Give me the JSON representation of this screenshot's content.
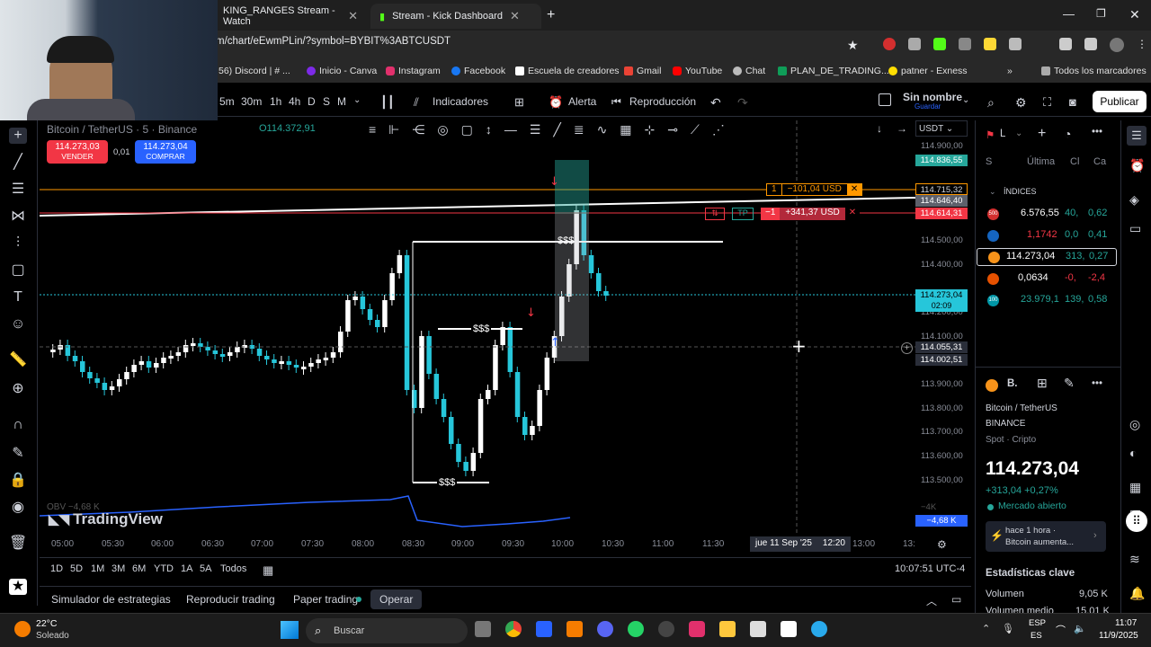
{
  "browser": {
    "tabs": [
      {
        "label": "KING_RANGES Stream - Watch"
      },
      {
        "label": "Stream - Kick Dashboard"
      }
    ],
    "url": "m/chart/eEwmPLin/?symbol=BYBIT%3ABTCUSDT",
    "bookmarks": [
      "56) Discord | # ...",
      "Inicio - Canva",
      "Instagram",
      "Facebook",
      "Escuela de creadores",
      "Gmail",
      "YouTube",
      "Chat",
      "PLAN_DE_TRADING...",
      "patner - Exness",
      "Todos los marcadores"
    ]
  },
  "toolbar": {
    "intervals": [
      "5m",
      "30m",
      "1h",
      "4h",
      "D",
      "S",
      "M"
    ],
    "indicators": "Indicadores",
    "alert": "Alerta",
    "replay": "Reproducción",
    "layout_name": "Sin nombre",
    "layout_saved": "Guardar",
    "publish": "Publicar"
  },
  "symbol": {
    "title": "Bitcoin / TetherUS · 5 · Binance",
    "open_label": "O114.372,91",
    "sell_price": "114.273,03",
    "sell_label": "VENDER",
    "spread": "0,01",
    "buy_price": "114.273,04",
    "buy_label": "COMPRAR",
    "quote_currency": "USDT"
  },
  "chart_data": {
    "type": "candlestick",
    "yaxis_ticks": [
      "114.900,00",
      "114.500,00",
      "114.400,00",
      "114.200,00",
      "114.100,00",
      "113.900,00",
      "113.800,00",
      "113.700,00",
      "113.600,00",
      "113.500,00"
    ],
    "xaxis_ticks": [
      "05:00",
      "05:30",
      "06:00",
      "06:30",
      "07:00",
      "07:30",
      "08:00",
      "08:30",
      "09:00",
      "09:30",
      "10:00",
      "10:30",
      "11:00",
      "11:30",
      "13:00",
      "13:"
    ],
    "crosshair_date": "jue 11 Sep '25",
    "crosshair_time": "12:20",
    "price_tags": [
      {
        "value": "114.836,55",
        "color": "#26a69a"
      },
      {
        "value": "114.715,32",
        "color": "#000000"
      },
      {
        "value": "114.646,40",
        "color": "#5d606b"
      },
      {
        "value": "114.614,31",
        "color": "#f23645"
      },
      {
        "value": "114.273,04",
        "color": "#26c6da"
      },
      {
        "value": "02:09",
        "color": "#26c6da"
      },
      {
        "value": "114.055,31",
        "color": "#2a2e39"
      },
      {
        "value": "114.002,51",
        "color": "#2a2e39"
      }
    ],
    "orders": {
      "limit_qty": "1",
      "limit_pnl": "−101,04 USD",
      "position_qty": "−1",
      "position_pnl": "+341,37 USD",
      "tp_label": "TP"
    },
    "liquidity_label": "$$$",
    "obv_label": "OBV −4,68 K",
    "obv_value": "−4,68 K",
    "obv_tick": "−4K",
    "watermark": "TradingView"
  },
  "range": {
    "buttons": [
      "1D",
      "5D",
      "1M",
      "3M",
      "6M",
      "YTD",
      "1A",
      "5A",
      "Todos"
    ],
    "clock": "10:07:51 UTC-4"
  },
  "bottom": {
    "tabs": [
      "Simulador de estrategias",
      "Reproducir trading",
      "Paper trading",
      "Operar"
    ]
  },
  "watchlist": {
    "header": "L",
    "cols": [
      "S",
      "Última",
      "Cl",
      "Ca"
    ],
    "section": "ÍNDICES",
    "rows": [
      {
        "icon": "500",
        "last": "6.576,55",
        "chg": "40,",
        "pct": "0,62",
        "color": "#26a69a",
        "iconcolor": "#d32f2f"
      },
      {
        "icon": "",
        "last": "1,1742",
        "chg": "0,0",
        "pct": "0,41",
        "color": "#f23645",
        "iconcolor": "#1565c0"
      },
      {
        "icon": "",
        "last": "114.273,04",
        "chg": "313,",
        "pct": "0,27",
        "color": "#ffffff",
        "iconcolor": "#f7931a"
      },
      {
        "icon": "",
        "last": "0,0634",
        "chg": "-0,",
        "pct": "-2,4",
        "color": "#ffffff",
        "iconcolor": "#e65100"
      },
      {
        "icon": "100",
        "last": "23.979,1",
        "chg": "139,",
        "pct": "0,58",
        "color": "#26a69a",
        "iconcolor": "#0097a7"
      }
    ]
  },
  "details": {
    "symbol_short": "B.",
    "name": "Bitcoin / TetherUS",
    "exchange": "BINANCE",
    "type": "Spot · Cripto",
    "price": "114.273,04",
    "change": "+313,04  +0,27%",
    "market": "Mercado abierto",
    "news_time": "hace 1 hora ·",
    "news_text": "Bitcoin aumenta...",
    "stats_title": "Estadísticas clave",
    "volume_label": "Volumen",
    "volume_value": "9,05 K",
    "avg_volume_label": "Volumen medio",
    "avg_volume_value": "15,01 K"
  },
  "taskbar": {
    "weather_temp": "22°C",
    "weather_text": "Soleado",
    "search": "Buscar",
    "lang": "ESP",
    "lang2": "ES",
    "time": "11:07",
    "date": "11/9/2025"
  }
}
